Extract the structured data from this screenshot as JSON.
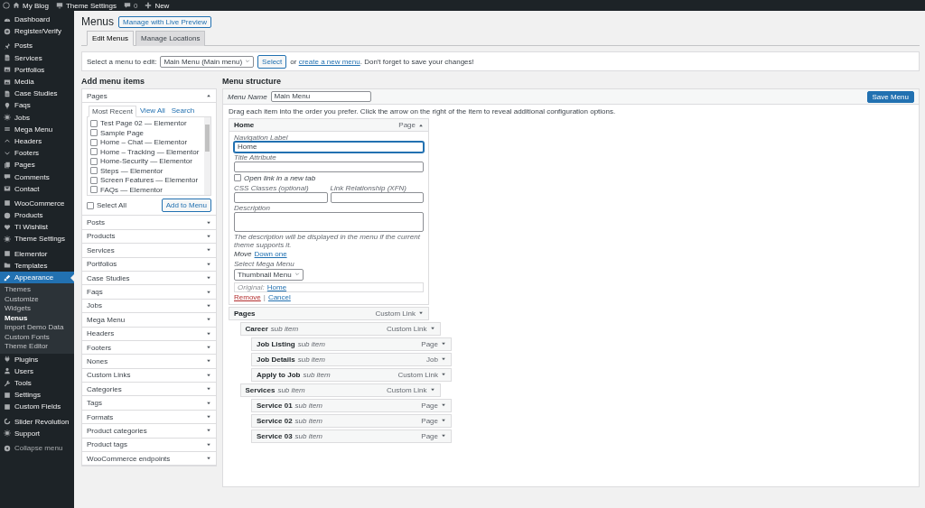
{
  "top_bar": {
    "site": "My Blog",
    "theme_settings": "Theme Settings",
    "comments": "0",
    "new": "New"
  },
  "sidebar": {
    "groups": [
      [
        {
          "label": "Dashboard",
          "selected": false
        },
        {
          "label": "Register/Verify",
          "selected": false
        }
      ],
      [
        {
          "label": "Posts",
          "selected": false
        },
        {
          "label": "Services",
          "selected": false
        },
        {
          "label": "Portfolios",
          "selected": false
        },
        {
          "label": "Media",
          "selected": false
        },
        {
          "label": "Case Studies",
          "selected": false
        },
        {
          "label": "Faqs",
          "selected": false
        },
        {
          "label": "Jobs",
          "selected": false
        },
        {
          "label": "Mega Menu",
          "selected": false
        },
        {
          "label": "Headers",
          "selected": false
        },
        {
          "label": "Footers",
          "selected": false
        },
        {
          "label": "Pages",
          "selected": false
        },
        {
          "label": "Comments",
          "selected": false
        },
        {
          "label": "Contact",
          "selected": false
        }
      ],
      [
        {
          "label": "WooCommerce",
          "selected": false
        },
        {
          "label": "Products",
          "selected": false
        },
        {
          "label": "TI Wishlist",
          "selected": false
        },
        {
          "label": "Theme Settings",
          "selected": false
        }
      ],
      [
        {
          "label": "Elementor",
          "selected": false
        },
        {
          "label": "Templates",
          "selected": false
        },
        {
          "label": "Appearance",
          "selected": true,
          "children": [
            {
              "label": "Themes",
              "selected": false
            },
            {
              "label": "Customize",
              "selected": false
            },
            {
              "label": "Widgets",
              "selected": false
            },
            {
              "label": "Menus",
              "selected": true
            },
            {
              "label": "Import Demo Data",
              "selected": false
            },
            {
              "label": "Custom Fonts",
              "selected": false
            },
            {
              "label": "Theme Editor",
              "selected": false
            }
          ]
        },
        {
          "label": "Plugins",
          "selected": false
        },
        {
          "label": "Users",
          "selected": false
        },
        {
          "label": "Tools",
          "selected": false
        },
        {
          "label": "Settings",
          "selected": false
        },
        {
          "label": "Custom Fields",
          "selected": false
        }
      ],
      [
        {
          "label": "Slider Revolution",
          "selected": false
        },
        {
          "label": "Support",
          "selected": false
        }
      ]
    ],
    "collapse": "Collapse menu"
  },
  "title": "Menus",
  "live_preview": "Manage with Live Preview",
  "tabs": [
    {
      "label": "Edit Menus",
      "selected": true
    },
    {
      "label": "Manage Locations",
      "selected": false
    }
  ],
  "menu_select": {
    "label": "Select a menu to edit:",
    "value": "Main Menu (Main menu)",
    "button": "Select",
    "note": {
      "before": "or",
      "link": "create a new menu",
      "after": ". Don't forget to save your changes!"
    }
  },
  "add_items": {
    "heading": "Add menu items",
    "sections": [
      {
        "label": "Pages",
        "expanded": true
      },
      {
        "label": "Posts",
        "expanded": false
      },
      {
        "label": "Products",
        "expanded": false
      },
      {
        "label": "Services",
        "expanded": false
      },
      {
        "label": "Portfolios",
        "expanded": false
      },
      {
        "label": "Case Studies",
        "expanded": false
      },
      {
        "label": "Faqs",
        "expanded": false
      },
      {
        "label": "Jobs",
        "expanded": false
      },
      {
        "label": "Mega Menu",
        "expanded": false
      },
      {
        "label": "Headers",
        "expanded": false
      },
      {
        "label": "Footers",
        "expanded": false
      },
      {
        "label": "Nones",
        "expanded": false
      },
      {
        "label": "Custom Links",
        "expanded": false
      },
      {
        "label": "Categories",
        "expanded": false
      },
      {
        "label": "Tags",
        "expanded": false
      },
      {
        "label": "Formats",
        "expanded": false
      },
      {
        "label": "Product categories",
        "expanded": false
      },
      {
        "label": "Product tags",
        "expanded": false
      },
      {
        "label": "WooCommerce endpoints",
        "expanded": false
      }
    ],
    "pages": {
      "tabs": [
        {
          "label": "Most Recent",
          "selected": true
        },
        {
          "label": "View All",
          "selected": false
        },
        {
          "label": "Search",
          "selected": false
        }
      ],
      "items": [
        {
          "label": "Test Page 02 — Elementor",
          "checked": false
        },
        {
          "label": "Sample Page",
          "checked": false
        },
        {
          "label": "Home – Chat — Elementor",
          "checked": false
        },
        {
          "label": "Home – Tracking — Elementor",
          "checked": false
        },
        {
          "label": "Home-Security — Elementor",
          "checked": false
        },
        {
          "label": "Steps — Elementor",
          "checked": false
        },
        {
          "label": "Screen Features — Elementor",
          "checked": false
        },
        {
          "label": "FAQs — Elementor",
          "checked": false
        }
      ],
      "select_all": {
        "label": "Select All",
        "checked": false
      },
      "button": "Add to Menu"
    }
  },
  "menu_structure": {
    "heading": "Menu structure",
    "name_label": "Menu Name",
    "name_value": "Main Menu",
    "save": "Save Menu",
    "instructions": "Drag each item into the order you prefer. Click the arrow on the right of the item to reveal additional configuration options.",
    "items": [
      {
        "title": "Home",
        "type": "Page",
        "expanded": true,
        "settings": {
          "nav_label": {
            "label": "Navigation Label",
            "value": "Home"
          },
          "title_attr": {
            "label": "Title Attribute"
          },
          "new_tab": {
            "label": "Open link in a new tab",
            "checked": false
          },
          "css_classes": {
            "label": "CSS Classes (optional)"
          },
          "xfn": {
            "label": "Link Relationship (XFN)"
          },
          "description": {
            "label": "Description",
            "help": "The description will be displayed in the menu if the current theme supports it."
          },
          "move": {
            "label": "Move",
            "link": "Down one"
          },
          "mega_menu": {
            "label": "Select Mega Menu",
            "value": "Thumbnail Menu"
          },
          "original": {
            "label": "Original:",
            "link": "Home"
          },
          "remove": "Remove",
          "separator": "|",
          "cancel": "Cancel"
        }
      },
      {
        "title": "Pages",
        "type": "Custom Link",
        "expanded": false,
        "children": [
          {
            "title": "Career",
            "subtitle": "sub item",
            "type": "Custom Link",
            "expanded": false,
            "children": [
              {
                "title": "Job Listing",
                "subtitle": "sub item",
                "type": "Page",
                "expanded": false
              },
              {
                "title": "Job Details",
                "subtitle": "sub item",
                "type": "Job",
                "expanded": false
              },
              {
                "title": "Apply to Job",
                "subtitle": "sub item",
                "type": "Custom Link",
                "expanded": false
              }
            ]
          },
          {
            "title": "Services",
            "subtitle": "sub item",
            "type": "Custom Link",
            "expanded": false,
            "children": [
              {
                "title": "Service 01",
                "subtitle": "sub item",
                "type": "Page",
                "expanded": false
              },
              {
                "title": "Service 02",
                "subtitle": "sub item",
                "type": "Page",
                "expanded": false
              },
              {
                "title": "Service 03",
                "subtitle": "sub item",
                "type": "Page",
                "expanded": false
              }
            ]
          }
        ]
      }
    ]
  }
}
